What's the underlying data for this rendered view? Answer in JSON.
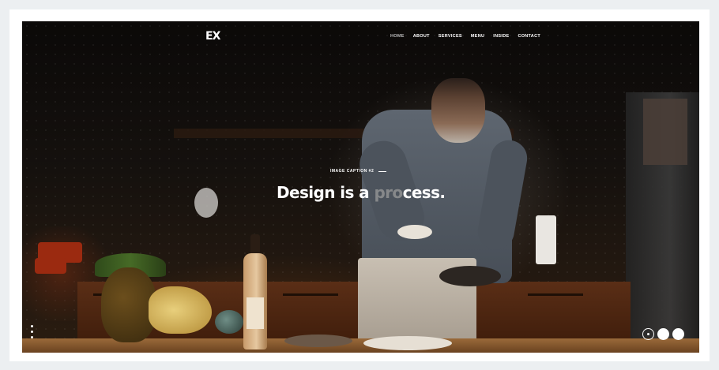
{
  "brand": {
    "logo_text": "EX"
  },
  "nav": {
    "items": [
      {
        "label": "HOME",
        "active": true
      },
      {
        "label": "ABOUT",
        "active": false
      },
      {
        "label": "SERVICES",
        "active": false
      },
      {
        "label": "MENU",
        "active": false
      },
      {
        "label": "INSIDE",
        "active": false
      },
      {
        "label": "CONTACT",
        "active": false
      }
    ]
  },
  "hero": {
    "caption": "IMAGE CAPTION #2",
    "headline_part1": "Design is a ",
    "headline_dim": "pro",
    "headline_part2": "cess.",
    "background": "chef plating food in a dim kitchen"
  },
  "slider": {
    "side_dots": 3,
    "controls": [
      "pause-icon",
      "slide-dot",
      "slide-dot"
    ]
  },
  "colors": {
    "background": "#0b0908",
    "text": "#ffffff",
    "frame": "#ffffff",
    "page": "#eceff1"
  }
}
